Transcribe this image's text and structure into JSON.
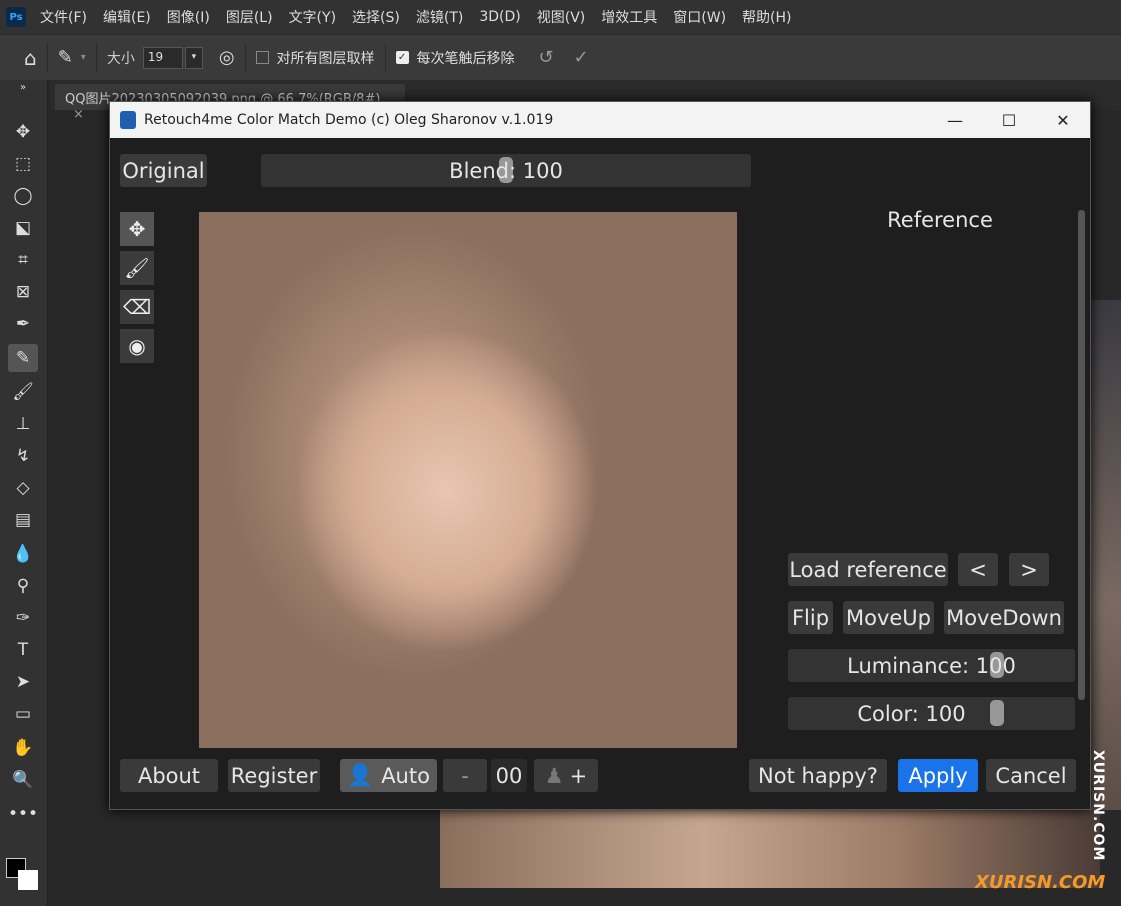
{
  "menubar": {
    "logo": "Ps",
    "items": [
      "文件(F)",
      "编辑(E)",
      "图像(I)",
      "图层(L)",
      "文字(Y)",
      "选择(S)",
      "滤镜(T)",
      "3D(D)",
      "视图(V)",
      "增效工具",
      "窗口(W)",
      "帮助(H)"
    ]
  },
  "options": {
    "size_label": "大小",
    "size_value": "19",
    "sample_all_layers": "对所有图层取样",
    "sample_all_checked": false,
    "remove_after_stroke": "每次笔触后移除",
    "remove_checked": true
  },
  "document_tab": {
    "title": "QQ图片20230305092039.png @ 66.7%(RGB/8#)",
    "close": "×"
  },
  "dialog": {
    "title": "Retouch4me Color Match Demo (c) Oleg Sharonov v.1.019",
    "original_label": "Original",
    "blend": {
      "label": "Blend: 100",
      "value": 100
    },
    "reference_label": "Reference",
    "load_reference": "Load reference",
    "prev": "<",
    "next": ">",
    "flip": "Flip",
    "move_up": "MoveUp",
    "move_down": "MoveDown",
    "luminance": {
      "label": "Luminance: 100",
      "value": 100
    },
    "color": {
      "label": "Color: 100",
      "value": 100
    },
    "about": "About",
    "register": "Register",
    "auto": "Auto",
    "minus": "-",
    "face_count": "00",
    "plus": "+",
    "not_happy": "Not happy?",
    "apply": "Apply",
    "cancel": "Cancel"
  },
  "watermark": {
    "vertical": "XURISN.COM",
    "logo": "XURISN.COM"
  },
  "colors": {
    "apply": "#1a73e8",
    "dialog_bg": "#1e1e1e",
    "ps_bg": "#323232"
  }
}
